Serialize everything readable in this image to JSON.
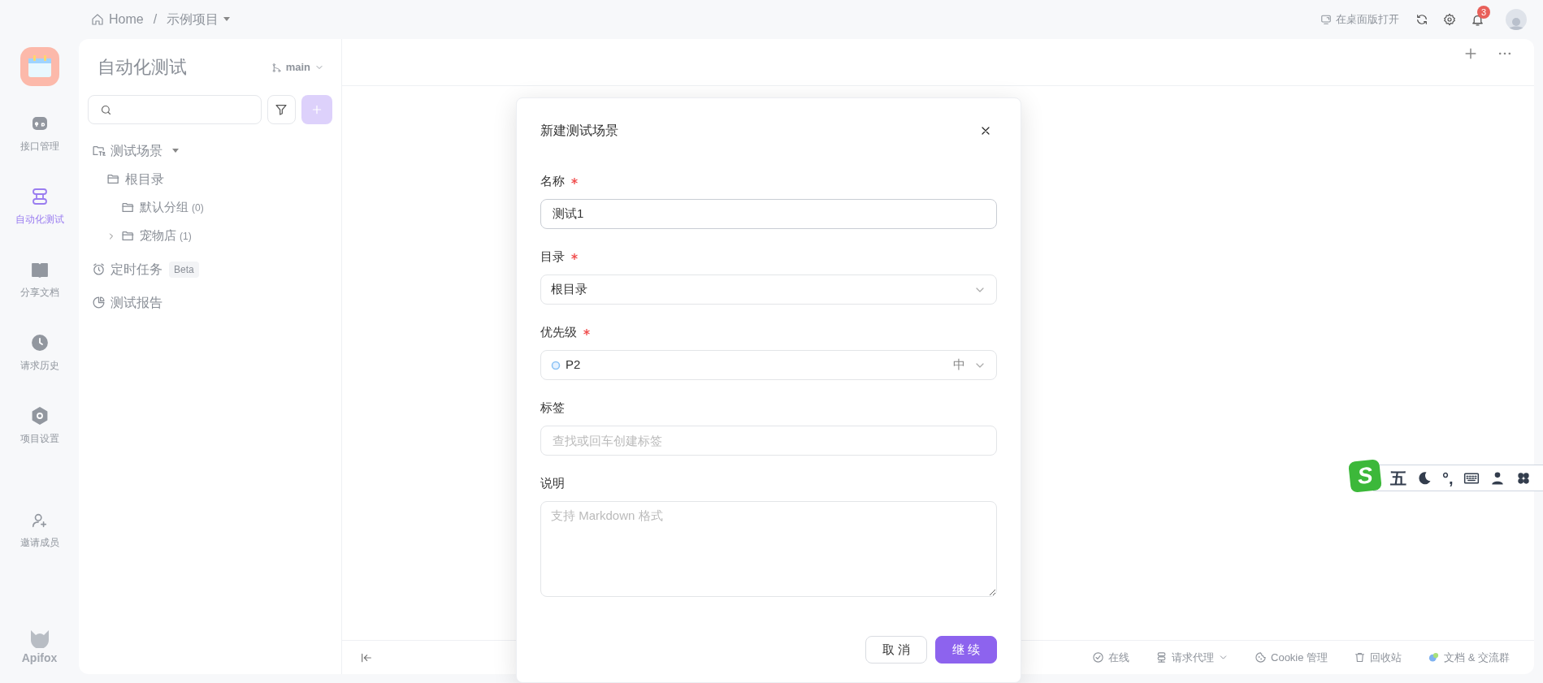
{
  "top_bar": {
    "breadcrumb": [
      {
        "label": "Home",
        "kind": "home"
      },
      {
        "label": "示例项目",
        "kind": "project"
      }
    ],
    "separator": "/",
    "open_desktop": "在桌面版打开",
    "notification_count": "3"
  },
  "nav": {
    "items": [
      {
        "label": "接口管理",
        "kind": "api",
        "selected": false
      },
      {
        "label": "自动化测试",
        "kind": "automation",
        "selected": true
      },
      {
        "label": "分享文档",
        "kind": "docs",
        "selected": false
      },
      {
        "label": "请求历史",
        "kind": "history",
        "selected": false
      },
      {
        "label": "项目设置",
        "kind": "settings",
        "selected": false
      }
    ],
    "invite": "邀请成员",
    "brand": "Apifox"
  },
  "panel": {
    "title": "自动化测试",
    "branch": "main",
    "tree": [
      {
        "label": "测试场景",
        "kind": "scenes",
        "children": [
          {
            "label": "根目录",
            "kind": "folder",
            "children": [
              {
                "label": "默认分组",
                "count": "(0)",
                "kind": "folder"
              },
              {
                "label": "宠物店",
                "count": "(1)",
                "kind": "folder",
                "expanded": false
              }
            ]
          }
        ]
      },
      {
        "label": "定时任务",
        "badge": "Beta",
        "kind": "schedule"
      },
      {
        "label": "测试报告",
        "kind": "report"
      }
    ]
  },
  "status_bar": {
    "items": [
      {
        "label": "在线",
        "kind": "online"
      },
      {
        "label": "请求代理",
        "kind": "proxy"
      },
      {
        "label": "Cookie 管理",
        "kind": "cookie"
      },
      {
        "label": "回收站",
        "kind": "trash"
      },
      {
        "label": "文档 & 交流群",
        "kind": "docs"
      }
    ]
  },
  "dialog": {
    "title": "新建测试场景",
    "fields": [
      {
        "label": "名称",
        "required": true,
        "kind": "text",
        "value": "测试1"
      },
      {
        "label": "目录",
        "required": true,
        "kind": "select",
        "value": "根目录"
      },
      {
        "label": "优先级",
        "required": true,
        "kind": "priority",
        "value": "P2",
        "level_text": "中"
      },
      {
        "label": "标签",
        "required": false,
        "kind": "text",
        "placeholder": "查找或回车创建标签"
      },
      {
        "label": "说明",
        "required": false,
        "kind": "textarea",
        "placeholder": "支持 Markdown 格式"
      }
    ],
    "buttons": [
      {
        "label": "取 消",
        "kind": "secondary"
      },
      {
        "label": "继 续",
        "kind": "primary"
      }
    ]
  },
  "ime_toolbar": {
    "logo": "S",
    "items": [
      {
        "kind": "text",
        "label": "五"
      },
      {
        "kind": "moon"
      },
      {
        "kind": "text",
        "label": "°,"
      },
      {
        "kind": "keyboard"
      },
      {
        "kind": "person"
      },
      {
        "kind": "clover"
      }
    ]
  }
}
